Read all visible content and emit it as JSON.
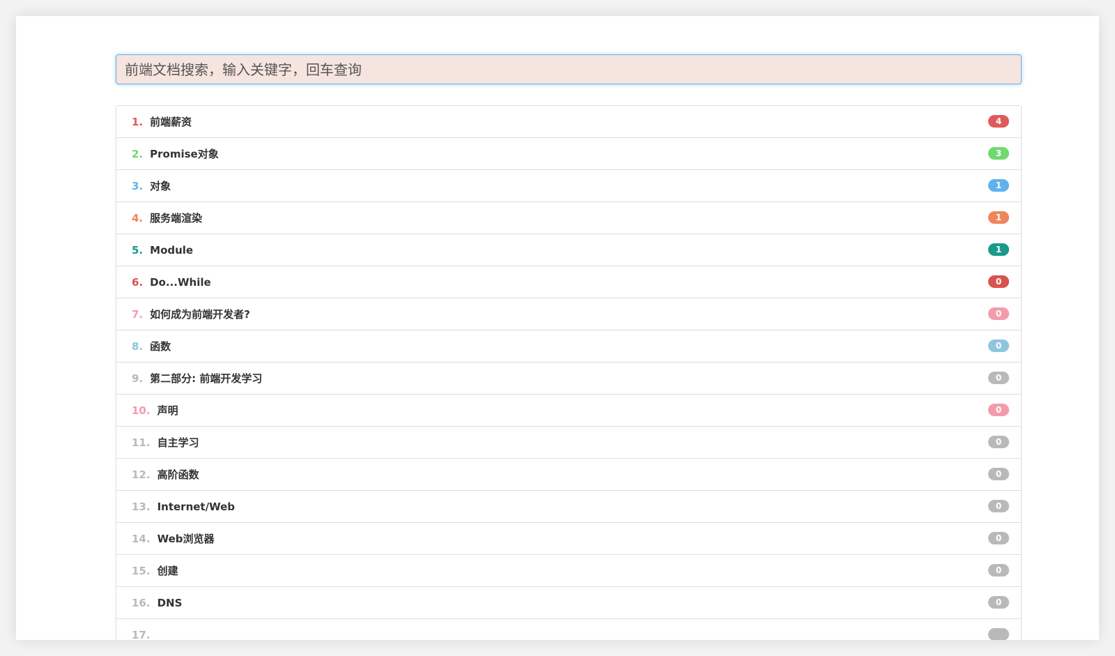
{
  "search": {
    "placeholder": "前端文档搜索，输入关键字，回车查询",
    "value": ""
  },
  "colors": {
    "input_bg": "#f6e4df",
    "input_focus_border": "#66afe9"
  },
  "list": {
    "items": [
      {
        "number": "1.",
        "title": "前端薪资",
        "count": "4",
        "color": "#e05a5a"
      },
      {
        "number": "2.",
        "title": "Promise对象",
        "count": "3",
        "color": "#6fd96f"
      },
      {
        "number": "3.",
        "title": "对象",
        "count": "1",
        "color": "#5fb2ec"
      },
      {
        "number": "4.",
        "title": "服务端渲染",
        "count": "1",
        "color": "#f0845c"
      },
      {
        "number": "5.",
        "title": "Module",
        "count": "1",
        "color": "#1b9a8c"
      },
      {
        "number": "6.",
        "title": "Do...While",
        "count": "0",
        "color": "#d9534f"
      },
      {
        "number": "7.",
        "title": "如何成为前端开发者?",
        "count": "0",
        "color": "#f29cab"
      },
      {
        "number": "8.",
        "title": "函数",
        "count": "0",
        "color": "#8ec5df"
      },
      {
        "number": "9.",
        "title": "第二部分: 前端开发学习",
        "count": "0",
        "color": "#b9b9b9"
      },
      {
        "number": "10.",
        "title": "声明",
        "count": "0",
        "color": "#f29cab"
      },
      {
        "number": "11.",
        "title": "自主学习",
        "count": "0",
        "color": "#b9b9b9"
      },
      {
        "number": "12.",
        "title": "高阶函数",
        "count": "0",
        "color": "#b9b9b9"
      },
      {
        "number": "13.",
        "title": "Internet/Web",
        "count": "0",
        "color": "#b9b9b9"
      },
      {
        "number": "14.",
        "title": "Web浏览器",
        "count": "0",
        "color": "#b9b9b9"
      },
      {
        "number": "15.",
        "title": "创建",
        "count": "0",
        "color": "#b9b9b9"
      },
      {
        "number": "16.",
        "title": "DNS",
        "count": "0",
        "color": "#b9b9b9"
      },
      {
        "number": "17.",
        "title": "",
        "count": "",
        "color": "#b9b9b9"
      }
    ]
  }
}
